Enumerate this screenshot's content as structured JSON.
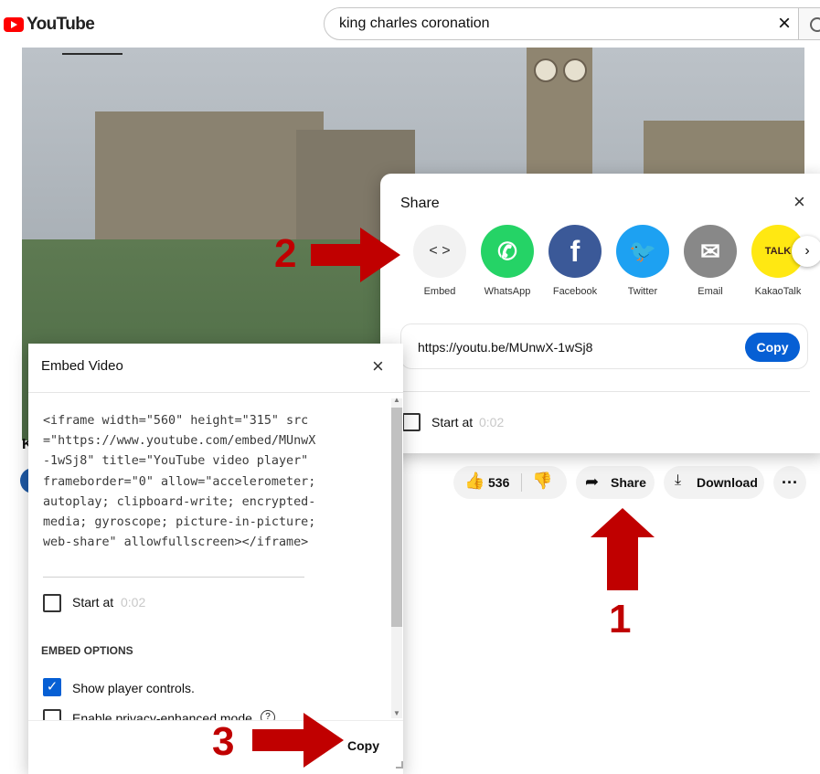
{
  "header": {
    "brand": "YouTube",
    "search_value": "king charles coronation",
    "clear_icon": "×"
  },
  "video": {
    "title_fragment": "K"
  },
  "actions": {
    "like_icon": "👍",
    "like_count": "536",
    "dislike_icon": "👎",
    "share_icon": "➦",
    "share_label": "Share",
    "download_icon": "⤓",
    "download_label": "Download",
    "more_label": "···"
  },
  "share_dialog": {
    "title": "Share",
    "close_icon": "×",
    "targets": [
      {
        "label": "Embed",
        "glyph": "< >",
        "color": "#f2f2f2"
      },
      {
        "label": "WhatsApp",
        "glyph": "✆",
        "color": "#25d366"
      },
      {
        "label": "Facebook",
        "glyph": "f",
        "color": "#3b5998"
      },
      {
        "label": "Twitter",
        "glyph": "🐦",
        "color": "#1da1f2"
      },
      {
        "label": "Email",
        "glyph": "✉",
        "color": "#888888"
      },
      {
        "label": "KakaoTalk",
        "glyph": "TALK",
        "color": "#ffe812"
      }
    ],
    "next_icon": "›",
    "url": "https://youtu.be/MUnwX-1wSj8",
    "copy_label": "Copy",
    "start_label": "Start at",
    "start_time": "0:02"
  },
  "embed_dialog": {
    "title": "Embed Video",
    "close_icon": "×",
    "code": "<iframe width=\"560\" height=\"315\" src=\"https://www.youtube.com/embed/MUnwX-1wSj8\" title=\"YouTube video player\" frameborder=\"0\" allow=\"accelerometer; autoplay; clipboard-write; encrypted-media; gyroscope; picture-in-picture; web-share\" allowfullscreen></iframe>",
    "start_label": "Start at",
    "start_time": "0:02",
    "options_heading": "EMBED OPTIONS",
    "option_controls_label": "Show player controls.",
    "option_controls_checked": true,
    "option_privacy_label": "Enable privacy-enhanced mode.",
    "copy_label": "Copy"
  },
  "annotations": {
    "step1": "1",
    "step2": "2",
    "step3": "3",
    "color": "#c00000"
  }
}
